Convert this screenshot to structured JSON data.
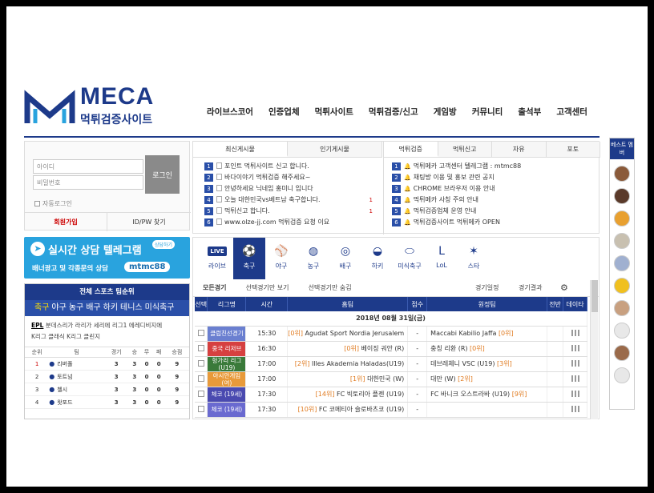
{
  "brand": {
    "name": "MECA",
    "subtitle": "먹튀검증사이트"
  },
  "nav": [
    "라이브스코어",
    "인증업체",
    "먹튀사이트",
    "먹튀검증/신고",
    "게임방",
    "커뮤니티",
    "출석부",
    "고객센터"
  ],
  "login": {
    "id_placeholder": "아이디",
    "pw_placeholder": "비밀번호",
    "login_button": "로그인",
    "auto_login": "자동로그인",
    "join": "회원가입",
    "find": "ID/PW 찾기"
  },
  "banner": {
    "title": "실시간 상담 텔레그램",
    "chat_badge": "상담하기",
    "line2": "배너광고 및 각종문의 상담",
    "telegram_id": "mtmc88"
  },
  "rank": {
    "header": "전체 스포츠 팀순위",
    "sports": [
      "축구",
      "야구",
      "농구",
      "배구",
      "하키",
      "테니스",
      "미식축구"
    ],
    "active_sport": 0,
    "league_line1_bold": "EPL",
    "league_line1": " 분데스리가 라리가 세리에 리그1 에레디비지에",
    "league_line2": "K리그 클래식 K리그 클린지",
    "columns": [
      "순위",
      "팀",
      "경기",
      "승",
      "무",
      "패",
      "승점"
    ],
    "rows": [
      {
        "rank": "1",
        "team": "리버풀",
        "p": "3",
        "w": "3",
        "d": "0",
        "l": "0",
        "pts": "9"
      },
      {
        "rank": "2",
        "team": "토트넘",
        "p": "3",
        "w": "3",
        "d": "0",
        "l": "0",
        "pts": "9"
      },
      {
        "rank": "3",
        "team": "첼시",
        "p": "3",
        "w": "3",
        "d": "0",
        "l": "0",
        "pts": "9"
      },
      {
        "rank": "4",
        "team": "왓포드",
        "p": "3",
        "w": "3",
        "d": "0",
        "l": "0",
        "pts": "9"
      }
    ]
  },
  "boards_left": {
    "tabs": [
      "최신게시물",
      "인기게시물"
    ],
    "active": 0,
    "posts": [
      {
        "n": "1",
        "title": "포인트 먹튀사이트 신고 합니다.",
        "count": ""
      },
      {
        "n": "2",
        "title": "바다이야기 먹튀검증 해주세요~",
        "count": ""
      },
      {
        "n": "3",
        "title": "안녕하세요 닉네임 홍미니 입니다",
        "count": ""
      },
      {
        "n": "4",
        "title": "오늘 대한민국vs베트남 축구합니다.",
        "count": "1"
      },
      {
        "n": "5",
        "title": "먹튀신고 합니다.",
        "count": "1"
      },
      {
        "n": "6",
        "title": "www.olze-jj.com 먹튀검증 요청 이요",
        "count": ""
      }
    ]
  },
  "boards_right": {
    "tabs": [
      "먹튀검증",
      "먹튀신고",
      "자유",
      "포토"
    ],
    "active": 0,
    "posts": [
      {
        "n": "1",
        "title": "먹튀메카 고객센터 텔레그램 : mtmc88"
      },
      {
        "n": "2",
        "title": "채팅방 이용 및 홍보 관련 공지"
      },
      {
        "n": "3",
        "title": "CHROME 브라우저 이용 안내"
      },
      {
        "n": "4",
        "title": "먹튀메카 사칭 주의 안내"
      },
      {
        "n": "5",
        "title": "먹튀검증업체 운영 안내"
      },
      {
        "n": "6",
        "title": "먹튀검증사이트 먹튀메카 OPEN"
      }
    ]
  },
  "sport_tabs": [
    {
      "label": "라이브",
      "icon": "live-icon",
      "glyph": "LIVE"
    },
    {
      "label": "축구",
      "icon": "soccer-ball-icon",
      "glyph": "⚽"
    },
    {
      "label": "야구",
      "icon": "baseball-icon",
      "glyph": "⚾"
    },
    {
      "label": "농구",
      "icon": "basketball-icon",
      "glyph": "◍"
    },
    {
      "label": "배구",
      "icon": "volleyball-icon",
      "glyph": "◎"
    },
    {
      "label": "하키",
      "icon": "hockey-icon",
      "glyph": "◒"
    },
    {
      "label": "미식축구",
      "icon": "football-icon",
      "glyph": "⬭"
    },
    {
      "label": "LoL",
      "icon": "lol-icon",
      "glyph": "L"
    },
    {
      "label": "스타",
      "icon": "starcraft-icon",
      "glyph": "✶"
    }
  ],
  "active_sport_tab": 1,
  "filters": {
    "all": "모든경기",
    "show_selected": "선택경기만 보기",
    "hide_selected": "선택경기만 숨김",
    "schedule": "경기일정",
    "results": "경기결과",
    "settings_icon": "gear-icon"
  },
  "game_columns": [
    "선택",
    "리그명",
    "시간",
    "홈팀",
    "점수",
    "원정팀",
    "전반",
    "데이타"
  ],
  "game_date": "2018년 08월 31일(금)",
  "games": [
    {
      "league": "클럽친선경기",
      "color": "#6a7fd0",
      "time": "15:30",
      "home_rank": "[0위]",
      "home": "Agudat Sport Nordia Jerusalem",
      "score": "-",
      "away": "Maccabi Kabilio Jaffa",
      "away_rank": "[0위]"
    },
    {
      "league": "중국 리저브",
      "color": "#d64040",
      "time": "16:30",
      "home_rank": "[0위]",
      "home": "베이징 궈안 (R)",
      "score": "-",
      "away": "충칭 리환 (R)",
      "away_rank": "[0위]"
    },
    {
      "league": "헝가리 리그 (U19)",
      "color": "#3a7a3a",
      "time": "17:00",
      "home_rank": "[2위]",
      "home": "Illes Akademia Haladas(U19)",
      "score": "-",
      "away": "데브레체니 VSC (U19)",
      "away_rank": "[3위]"
    },
    {
      "league": "아시안게임 (여)",
      "color": "#e89a3a",
      "time": "17:00",
      "home_rank": "[1위]",
      "home": "대한민국 (W)",
      "score": "-",
      "away": "대만 (W)",
      "away_rank": "[2위]"
    },
    {
      "league": "체코 (19세)",
      "color": "#4a4ab0",
      "time": "17:30",
      "home_rank": "[14위]",
      "home": "FC 빅토리아 플젠 (U19)",
      "score": "-",
      "away": "FC 바니크 오스트라바 (U19)",
      "away_rank": "[9위]"
    },
    {
      "league": "체코 (19세)",
      "color": "#6a6ad0",
      "time": "17:30",
      "home_rank": "[10위]",
      "home": "FC 코메티아 슬로바츠코 (U19)",
      "score": "-",
      "away": "",
      "away_rank": ""
    }
  ],
  "best_members": {
    "header": "베스트 멤버"
  },
  "colors": {
    "primary": "#1d3a8a",
    "accent": "#29a3de",
    "rank_text": "#e07a1f"
  }
}
